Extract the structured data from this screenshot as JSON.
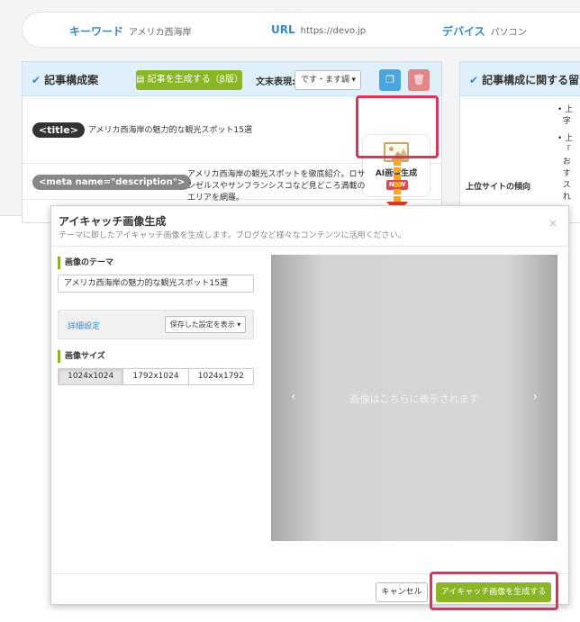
{
  "keyword_bar": {
    "keyword_label": "キーワード",
    "keyword_value": "アメリカ西海岸",
    "url_label": "URL",
    "url_value": "https://devo.jp",
    "device_label": "デバイス",
    "device_value": "パソコン"
  },
  "structure_panel": {
    "title": "記事構成案",
    "generate_article_label": "記事を生成する（β版）",
    "ending_label": "文末表現:",
    "ending_value": "です・ます調",
    "rows": [
      {
        "tag": "<title>",
        "text": "アメリカ西海岸の魅力的な観光スポット15選"
      },
      {
        "tag": "<meta name=\"description\">",
        "text": "アメリカ西海岸の観光スポットを徹底紹介。ロサンゼルスやサンフランシスコなど見どころ満載のエリアを網羅。"
      }
    ],
    "ai_image_button_label": "AI画像生成",
    "ai_image_badge": "NEW"
  },
  "notes_panel": {
    "title": "記事構成に関する留",
    "trend_label": "上位サイトの傾向",
    "bullets": [
      "上",
      "字",
      "上",
      "「",
      "お",
      "す",
      "ス",
      "れ"
    ]
  },
  "modal": {
    "title": "アイキャッチ画像生成",
    "subtitle": "テーマに即したアイキャッチ画像を生成します。ブログなど様々なコンテンツに活用ください。",
    "close_symbol": "×",
    "theme_label": "画像のテーマ",
    "theme_value": "アメリカ西海岸の魅力的な観光スポット15選",
    "detail_link": "詳細設定",
    "saved_settings_label": "保存した設定を表示 ▾",
    "size_label": "画像サイズ",
    "sizes": [
      "1024x1024",
      "1792x1024",
      "1024x1792"
    ],
    "selected_size": "1024x1024",
    "preview_placeholder": "画像はこちらに表示されます",
    "prev_symbol": "‹",
    "next_symbol": "›",
    "cancel_label": "キャンセル",
    "generate_label": "アイキャッチ画像を生成する"
  },
  "colors": {
    "accent_green": "#8ab524",
    "highlight_pink": "#d9345a",
    "link_blue": "#3a87c5",
    "arrow_orange": "#f5a623"
  }
}
